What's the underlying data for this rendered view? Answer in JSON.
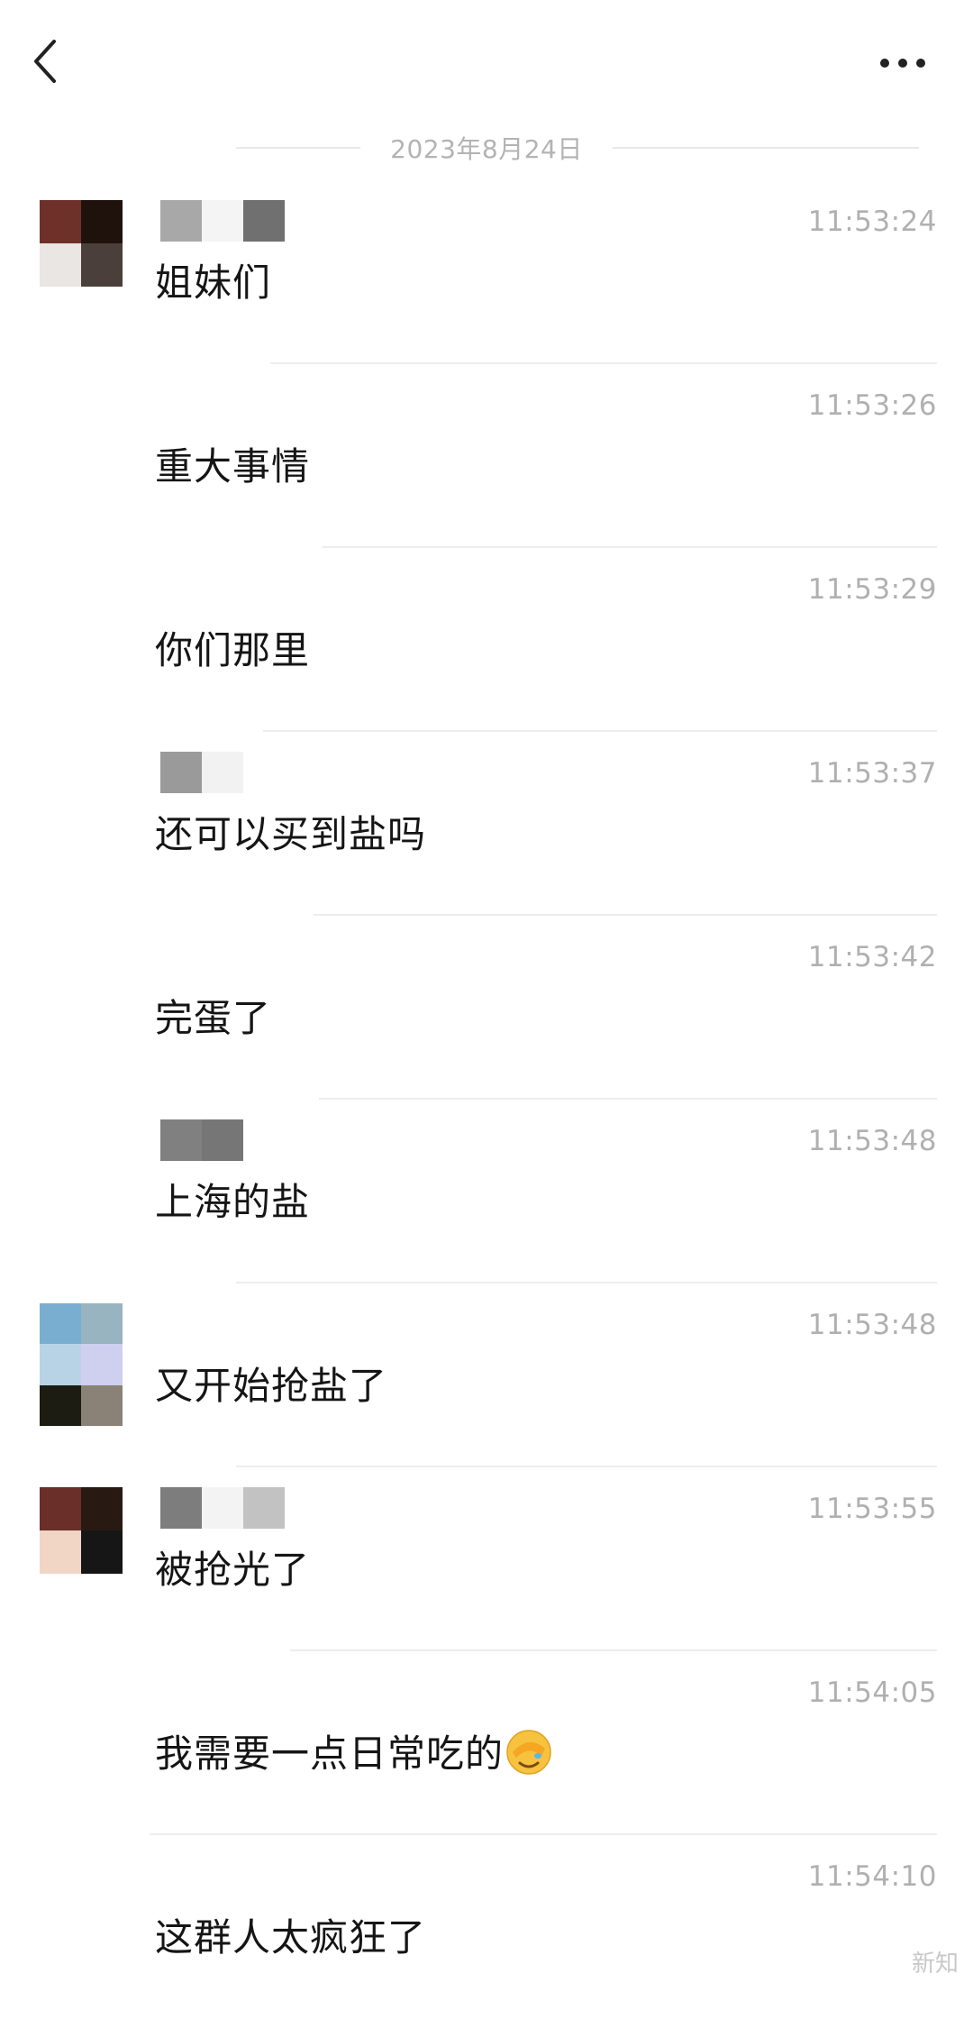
{
  "header": {
    "back_icon": "chevron-left-icon",
    "more_icon": "more-dots-icon"
  },
  "date_separator": "2023年8月24日",
  "messages": [
    {
      "time": "11:53:24",
      "text": "姐妹们",
      "avatar": [
        "#6e3129",
        "#1f120c",
        "#e9e6e3",
        "#4a3f3a"
      ],
      "name_blocks": [
        "#a8a8a8",
        "#f4f4f4",
        "#707070"
      ]
    },
    {
      "time": "11:53:26",
      "text": "重大事情"
    },
    {
      "time": "11:53:29",
      "text": "你们那里"
    },
    {
      "time": "11:53:37",
      "text": "还可以买到盐吗",
      "name_blocks": [
        "#9a9a9a",
        "#f2f2f2"
      ]
    },
    {
      "time": "11:53:42",
      "text": "完蛋了"
    },
    {
      "time": "11:53:48",
      "text": "上海的盐",
      "name_blocks": [
        "#808080",
        "#767676"
      ]
    },
    {
      "time": "11:53:48",
      "text": "又开始抢盐了",
      "avatar": [
        "#7aaed0",
        "#98b4c0",
        "#b9d3e6",
        "#cfcff0",
        "#1c1c12",
        "#8a8276"
      ]
    },
    {
      "time": "11:53:55",
      "text": "被抢光了",
      "avatar": [
        "#6a2f28",
        "#281a12",
        "#f1d6c6",
        "#161616"
      ],
      "name_blocks": [
        "#7d7d7d",
        "#f3f3f3",
        "#c2c2c2"
      ]
    },
    {
      "time": "11:54:05",
      "text": "我需要一点日常吃的",
      "emoji": "face-palm-emoji"
    },
    {
      "time": "11:54:10",
      "text": "这群人太疯狂了"
    }
  ],
  "watermark": "新知"
}
